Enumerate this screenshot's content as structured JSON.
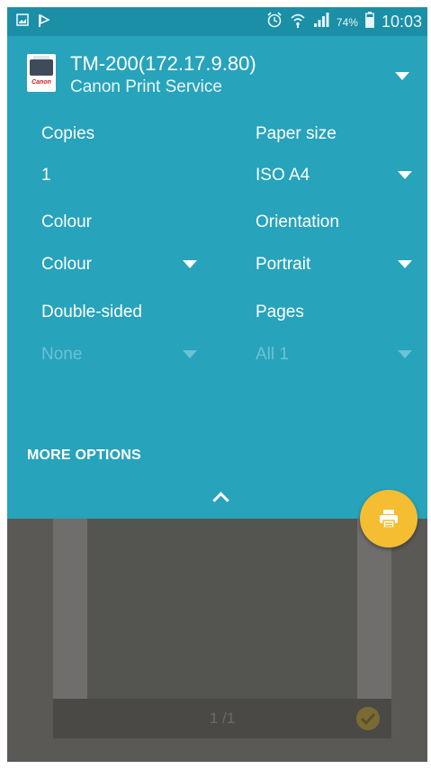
{
  "status_bar": {
    "battery_percent": "74%",
    "time": "10:03",
    "icons": [
      "image-icon",
      "flag-icon",
      "alarm-icon",
      "wifi-icon",
      "signal-icon",
      "battery-icon"
    ]
  },
  "printer": {
    "name": "TM-200(172.17.9.80)",
    "service": "Canon Print Service",
    "logo_text": "Canon"
  },
  "settings": {
    "copies": {
      "label": "Copies",
      "value": "1"
    },
    "paper_size": {
      "label": "Paper size",
      "value": "ISO A4"
    },
    "colour": {
      "label": "Colour",
      "value": "Colour"
    },
    "orientation": {
      "label": "Orientation",
      "value": "Portrait"
    },
    "double_sided": {
      "label": "Double-sided",
      "value": "None",
      "enabled": false
    },
    "pages": {
      "label": "Pages",
      "value": "All 1",
      "enabled": false
    }
  },
  "more_options_label": "MORE OPTIONS",
  "preview": {
    "page_indicator": "1 /1",
    "selected": true
  },
  "colors": {
    "panel": "#27a3bb",
    "status_bar": "#1a8fa6",
    "fab": "#f4bd32",
    "background": "#5a5956"
  }
}
